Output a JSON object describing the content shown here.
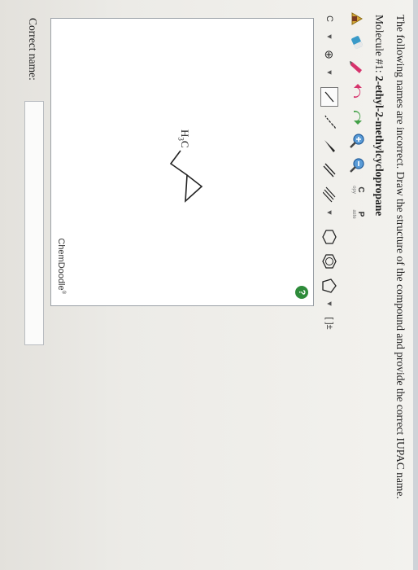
{
  "question": {
    "instructions": "The following names are incorrect. Draw the structure of the compound and provide the correct IUPAC name.",
    "molecule_prefix": "Molecule #1:",
    "molecule_name": "2-ethyl-2-methylcyclopropane"
  },
  "toolbar_top": {
    "copy_letter": "C",
    "copy_sub": "opy",
    "paste_letter": "P",
    "paste_sub": "aste"
  },
  "toolbar_bottom": {
    "element_label": "C",
    "charge_symbol": "⊕",
    "chain_label": "[ ]±"
  },
  "canvas": {
    "help_symbol": "?",
    "label_main": "H",
    "label_sub": "3",
    "label_tail": "C",
    "logo_text": "ChemDoodle",
    "logo_mark": "®"
  },
  "answer": {
    "label": "Correct name:",
    "value": ""
  }
}
